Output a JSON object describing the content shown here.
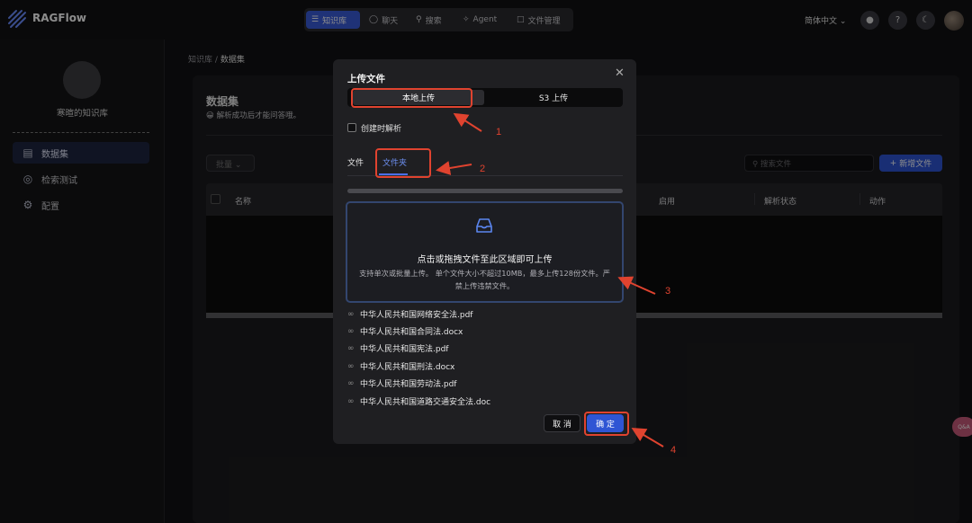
{
  "app": {
    "brand": "RAGFlow"
  },
  "nav": {
    "items": [
      {
        "label": "知识库",
        "icon": "database-icon"
      },
      {
        "label": "聊天",
        "icon": "chat-icon"
      },
      {
        "label": "搜索",
        "icon": "search-icon"
      },
      {
        "label": "Agent",
        "icon": "agent-icon"
      },
      {
        "label": "文件管理",
        "icon": "folder-icon"
      }
    ],
    "active_index": 0,
    "language": "简体中文"
  },
  "sidebar": {
    "kb_name": "寒暄的知识库",
    "items": [
      {
        "label": "数据集",
        "icon": "dataset-icon"
      },
      {
        "label": "检索测试",
        "icon": "retrieval-icon"
      },
      {
        "label": "配置",
        "icon": "gear-icon"
      }
    ]
  },
  "breadcrumb": {
    "root": "知识库",
    "sep": "/",
    "current": "数据集"
  },
  "page": {
    "title": "数据集",
    "subtitle": "😀 解析成功后才能问答哦。",
    "bulk_label": "批量",
    "search_placeholder": "搜索文件",
    "new_file_label": "新增文件",
    "columns": [
      "名称",
      "启用",
      "解析状态",
      "动作"
    ]
  },
  "modal": {
    "title": "上传文件",
    "segments": [
      "本地上传",
      "S3 上传"
    ],
    "parse_on_create": "创建时解析",
    "tabs": [
      "文件",
      "文件夹"
    ],
    "drop_main": "点击或拖拽文件至此区域即可上传",
    "drop_hint": "支持单次或批量上传。 单个文件大小不超过10MB，最多上传128份文件。严禁上传违禁文件。",
    "files": [
      "中华人民共和国网络安全法.pdf",
      "中华人民共和国合同法.docx",
      "中华人民共和国宪法.pdf",
      "中华人民共和国刑法.docx",
      "中华人民共和国劳动法.pdf",
      "中华人民共和国道路交通安全法.doc"
    ],
    "cancel_label": "取 消",
    "ok_label": "确 定"
  },
  "annotations": [
    "1",
    "2",
    "3",
    "4"
  ],
  "side_badge": "Q&A",
  "colors": {
    "accent": "#2f55d4",
    "annotation": "#e0432f",
    "background": "#121214"
  }
}
